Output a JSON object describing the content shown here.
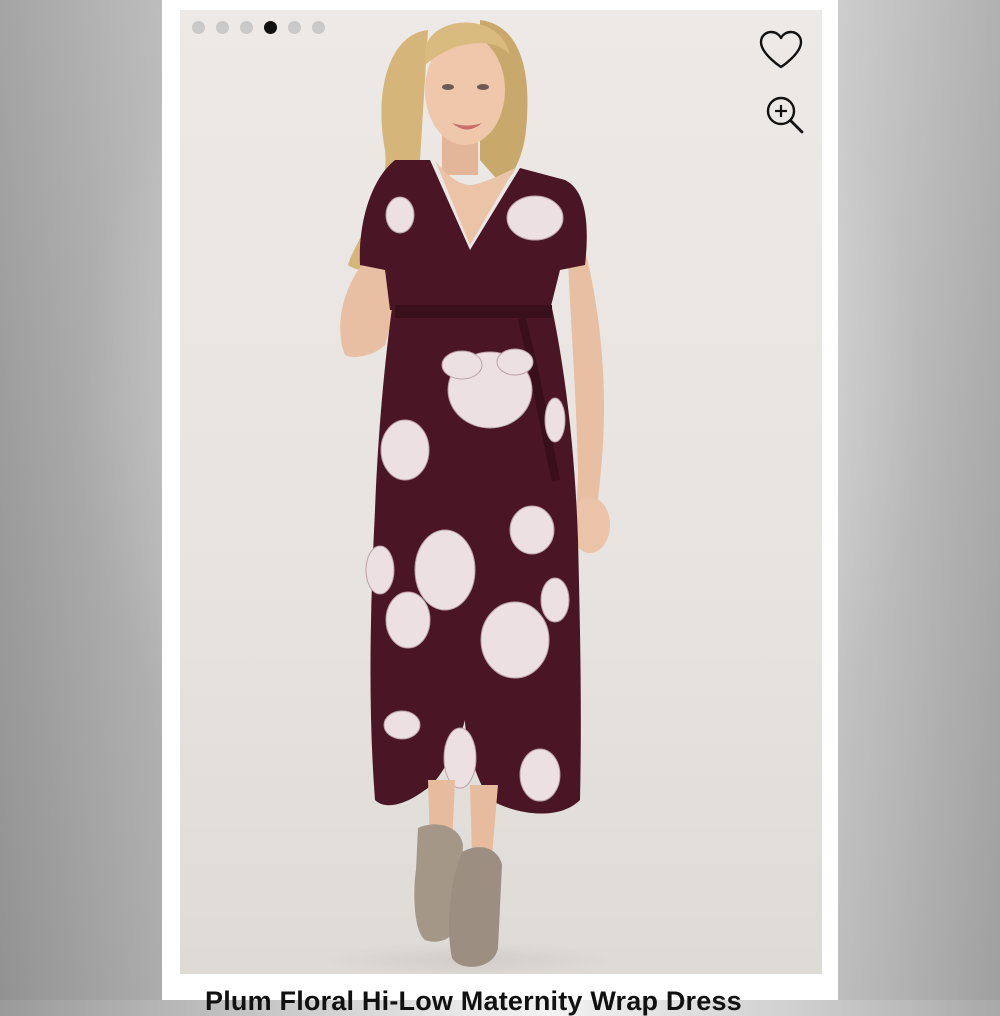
{
  "product": {
    "title": "Plum Floral Hi-Low Maternity Wrap Dress",
    "image_description_name": "product-photo",
    "gallery": {
      "total": 6,
      "active_index": 3
    }
  },
  "actions": {
    "favorite_icon": "heart-icon",
    "zoom_icon": "zoom-in-icon"
  },
  "colors": {
    "dress": "#4a1626",
    "flower": "#ece0e3",
    "boots": "#a59788",
    "skin": "#e8bfa3",
    "hair": "#d8b87a"
  }
}
